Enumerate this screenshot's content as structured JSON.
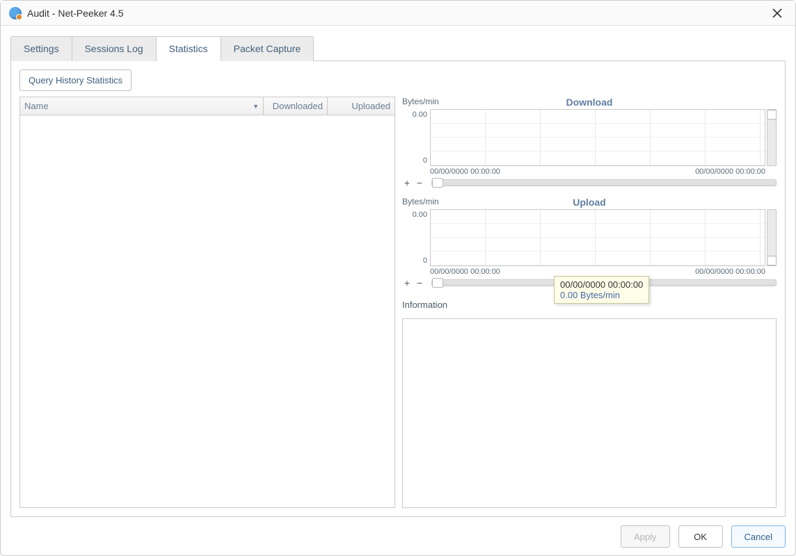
{
  "window": {
    "title": "Audit - Net-Peeker 4.5"
  },
  "tabs": {
    "settings": "Settings",
    "sessions_log": "Sessions Log",
    "statistics": "Statistics",
    "packet_capture": "Packet Capture"
  },
  "query_button": "Query History Statistics",
  "table": {
    "col_name": "Name",
    "col_downloaded": "Downloaded",
    "col_uploaded": "Uploaded"
  },
  "download_chart": {
    "ylabel": "Bytes/min",
    "title": "Download",
    "ymax": "0.00",
    "ymin": "0",
    "xstart": "00/00/0000 00:00:00",
    "xend": "00/00/0000 00:00:00"
  },
  "upload_chart": {
    "ylabel": "Bytes/min",
    "title": "Upload",
    "ymax": "0.00",
    "ymin": "0",
    "xstart": "00/00/0000 00:00:00",
    "xend": "00/00/0000 00:00:00"
  },
  "tooltip": {
    "time": "00/00/0000 00:00:00",
    "value": "0.00 Bytes/min"
  },
  "info_label": "Information",
  "buttons": {
    "apply": "Apply",
    "ok": "OK",
    "cancel": "Cancel"
  },
  "chart_data": [
    {
      "type": "line",
      "title": "Download",
      "ylabel": "Bytes/min",
      "ylim": [
        0,
        0
      ],
      "x_range": [
        "00/00/0000 00:00:00",
        "00/00/0000 00:00:00"
      ],
      "series": [
        {
          "name": "Download",
          "values": []
        }
      ]
    },
    {
      "type": "line",
      "title": "Upload",
      "ylabel": "Bytes/min",
      "ylim": [
        0,
        0
      ],
      "x_range": [
        "00/00/0000 00:00:00",
        "00/00/0000 00:00:00"
      ],
      "series": [
        {
          "name": "Upload",
          "values": []
        }
      ]
    }
  ]
}
